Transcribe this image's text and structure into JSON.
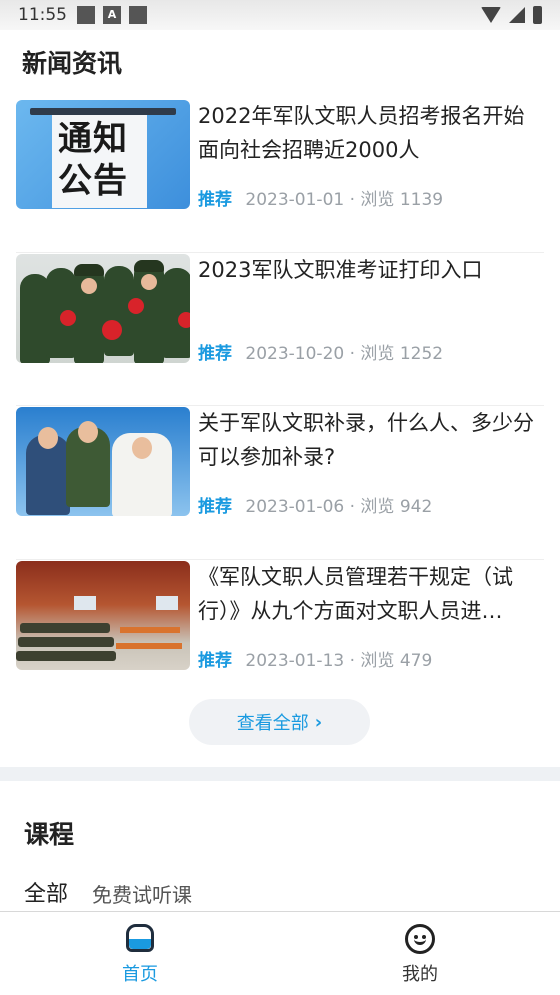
{
  "status_bar": {
    "time": "11:55",
    "notification_icons": [
      "square-icon",
      "a-icon",
      "square-icon"
    ],
    "right_icons": [
      "wifi-icon",
      "signal-icon",
      "battery-icon"
    ]
  },
  "news": {
    "section_title": "新闻资讯",
    "items": [
      {
        "title": "2022年军队文职人员招考报名开始面向社会招聘近2000人",
        "tag": "推荐",
        "date": "2023-01-01",
        "views": "浏览 1139",
        "thumb_text": "通知公告"
      },
      {
        "title": "2023军队文职准考证打印入口",
        "tag": "推荐",
        "date": "2023-10-20",
        "views": "浏览 1252"
      },
      {
        "title": "关于军队文职补录，什么人、多少分可以参加补录?",
        "tag": "推荐",
        "date": "2023-01-06",
        "views": "浏览 942"
      },
      {
        "title": "《军队文职人员管理若干规定（试行）》从九个方面对文职人员进…",
        "tag": "推荐",
        "date": "2023-01-13",
        "views": "浏览 479"
      }
    ],
    "view_all_label": "查看全部",
    "view_all_icon": "chevron-right-icon"
  },
  "courses": {
    "section_title": "课程",
    "tabs": [
      {
        "label": "全部",
        "active": true
      },
      {
        "label": "免费试听课",
        "active": false
      }
    ]
  },
  "bottom_nav": {
    "items": [
      {
        "label": "首页",
        "icon": "home-icon",
        "active": true
      },
      {
        "label": "我的",
        "icon": "smile-icon",
        "active": false
      }
    ]
  },
  "colors": {
    "accent": "#1a9ae0",
    "meta_text": "#9aa0a6",
    "divider": "#eef1f4"
  }
}
